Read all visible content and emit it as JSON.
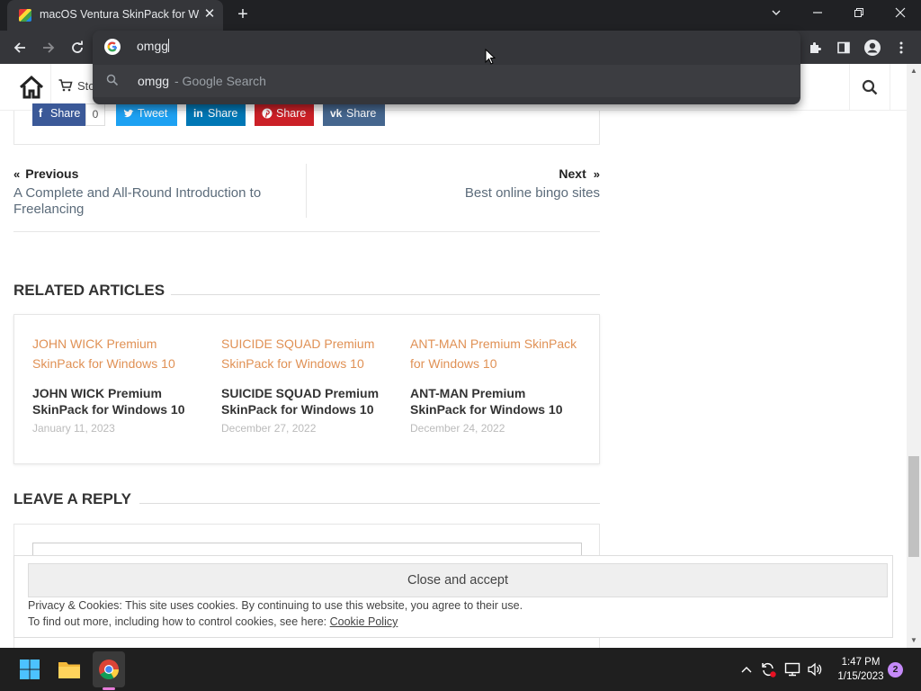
{
  "browser": {
    "tab": {
      "title": "macOS Ventura SkinPack for Win",
      "close_icon": "close-icon"
    },
    "newtab_label": "+",
    "omnibox": {
      "typed": "omgg",
      "suggestion": {
        "query": "omgg",
        "source": "- Google Search"
      }
    }
  },
  "site": {
    "header": {
      "store_label": "Sto"
    },
    "share": {
      "facebook_label": "Share",
      "facebook_count": "0",
      "twitter_label": "Tweet",
      "linkedin_label": "Share",
      "pinterest_label": "Share",
      "vk_label": "Share",
      "colors": {
        "facebook": "#3b5998",
        "twitter": "#1da1f2",
        "linkedin": "#0077b5",
        "pinterest": "#cb2027",
        "vk": "#45668e"
      }
    },
    "nav": {
      "prev_label": "Previous",
      "prev_title": "A Complete and All-Round Introduction to Freelancing",
      "next_label": "Next",
      "next_title": "Best online bingo sites"
    },
    "related": {
      "heading": "RELATED ARTICLES",
      "items": [
        {
          "image_alt": "JOHN WICK Premium SkinPack for Windows 10",
          "title": "JOHN WICK Premium SkinPack for Windows 10",
          "date": "January 11, 2023"
        },
        {
          "image_alt": "SUICIDE SQUAD Premium SkinPack for Windows 10",
          "title": "SUICIDE SQUAD Premium SkinPack for Windows 10",
          "date": "December 27, 2022"
        },
        {
          "image_alt": "ANT-MAN Premium SkinPack for Windows 10",
          "title": "ANT-MAN Premium SkinPack for Windows 10",
          "date": "December 24, 2022"
        }
      ]
    },
    "reply": {
      "heading": "LEAVE A REPLY"
    },
    "cookie": {
      "accept_label": "Close and accept",
      "line1": "Privacy & Cookies: This site uses cookies. By continuing to use this website, you agree to their use.",
      "line2_prefix": "To find out more, including how to control cookies, see here:",
      "policy_link": "Cookie Policy"
    }
  },
  "taskbar": {
    "time": "1:47 PM",
    "date": "1/15/2023",
    "notification_count": "2"
  }
}
